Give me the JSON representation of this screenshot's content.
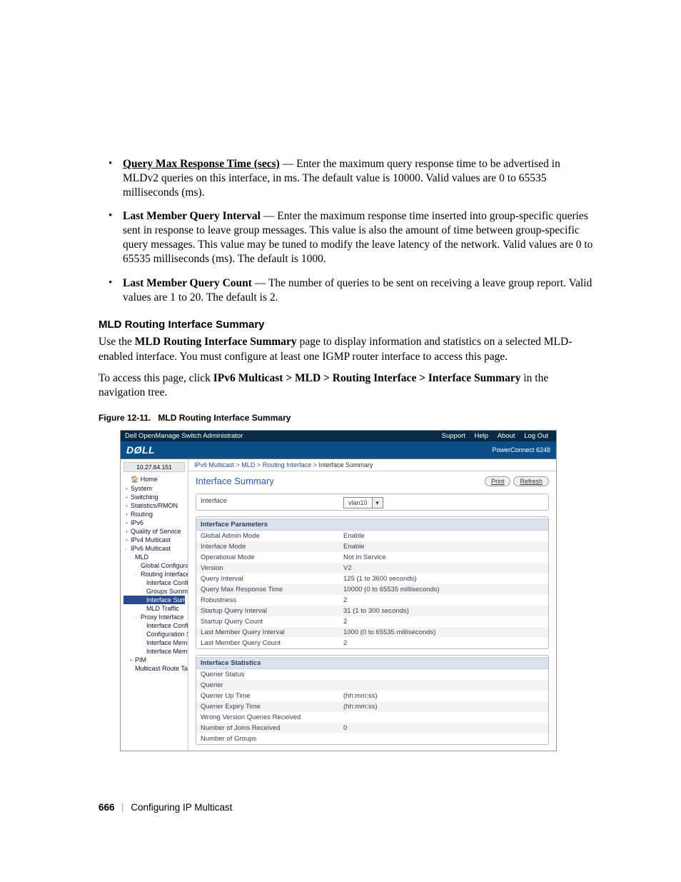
{
  "bullets": [
    {
      "term": "Query Max Response Time (secs)",
      "underline": true,
      "dash": " — ",
      "text": "Enter the maximum query response time to be advertised in MLDv2 queries on this interface, in ms. The default value is 10000. Valid values are 0 to 65535 milliseconds (ms)."
    },
    {
      "term": "Last Member Query Interval",
      "underline": false,
      "dash": " — ",
      "text": "Enter the maximum response time inserted into group-specific queries sent in response to leave group messages. This value is also the amount of time between group-specific query messages. This value may be tuned to modify the leave latency of the network. Valid values are 0 to 65535 milliseconds (ms). The default is 1000."
    },
    {
      "term": "Last Member Query Count",
      "underline": false,
      "dash": " — ",
      "text": "The number of queries to be sent on receiving a leave group report. Valid values are 1 to 20. The default is 2."
    }
  ],
  "section_title": "MLD Routing Interface Summary",
  "para1_pre": "Use the ",
  "para1_bold": "MLD Routing Interface Summary",
  "para1_post": " page to display information and statistics on a selected MLD-enabled interface. You must configure at least one IGMP router interface to access this page.",
  "para2_pre": "To access this page, click ",
  "para2_bold": "IPv6 Multicast > MLD > Routing Interface > Interface Summary",
  "para2_post": " in the navigation tree.",
  "fig_caption_num": "Figure 12-11.",
  "fig_caption_text": "MLD Routing Interface Summary",
  "shot": {
    "titlebar": {
      "title": "Dell OpenManage Switch Administrator",
      "links": [
        "Support",
        "Help",
        "About",
        "Log Out"
      ]
    },
    "brand": "DØLL",
    "model": "PowerConnect 6248",
    "ip": "10.27.64.151",
    "nav": [
      {
        "lvl": 0,
        "expand": "",
        "label": "Home",
        "sel": false,
        "home": true
      },
      {
        "lvl": 0,
        "expand": "+",
        "label": "System"
      },
      {
        "lvl": 0,
        "expand": "+",
        "label": "Switching"
      },
      {
        "lvl": 0,
        "expand": "+",
        "label": "Statistics/RMON"
      },
      {
        "lvl": 0,
        "expand": "+",
        "label": "Routing"
      },
      {
        "lvl": 0,
        "expand": "+",
        "label": "IPv6"
      },
      {
        "lvl": 0,
        "expand": "+",
        "label": "Quality of Service"
      },
      {
        "lvl": 0,
        "expand": "+",
        "label": "IPv4 Multicast"
      },
      {
        "lvl": 0,
        "expand": "-",
        "label": "IPv6 Multicast"
      },
      {
        "lvl": 1,
        "expand": "-",
        "label": "MLD"
      },
      {
        "lvl": 2,
        "expand": "",
        "label": "Global Configuratio"
      },
      {
        "lvl": 2,
        "expand": "-",
        "label": "Routing Interface"
      },
      {
        "lvl": 3,
        "expand": "",
        "label": "Interface Configu"
      },
      {
        "lvl": 3,
        "expand": "",
        "label": "Groups Summa"
      },
      {
        "lvl": 3,
        "expand": "",
        "label": "Interface Summ",
        "sel": true
      },
      {
        "lvl": 3,
        "expand": "",
        "label": "MLD Traffic"
      },
      {
        "lvl": 2,
        "expand": "-",
        "label": "Proxy Interface"
      },
      {
        "lvl": 3,
        "expand": "",
        "label": "Interface Configu"
      },
      {
        "lvl": 3,
        "expand": "",
        "label": "Configuration Su"
      },
      {
        "lvl": 3,
        "expand": "",
        "label": "Interface Membe"
      },
      {
        "lvl": 3,
        "expand": "",
        "label": "Interface Membe"
      },
      {
        "lvl": 1,
        "expand": "+",
        "label": "PIM"
      },
      {
        "lvl": 1,
        "expand": "",
        "label": "Multicast Route Table"
      }
    ],
    "crumbs": [
      "IPv6 Multicast",
      "MLD",
      "Routing Interface",
      "Interface Summary"
    ],
    "page_title": "Interface Summary",
    "buttons": {
      "print": "Print",
      "refresh": "Refresh"
    },
    "iface_label": "Interface",
    "iface_value": "vlan10",
    "params_header": "Interface Parameters",
    "params": [
      {
        "l": "Global Admin Mode",
        "v": "Enable"
      },
      {
        "l": "Interface Mode",
        "v": "Enable"
      },
      {
        "l": "Operational Mode",
        "v": "Not In Service"
      },
      {
        "l": "Version",
        "v": "V2"
      },
      {
        "l": "Query Interval",
        "v": "125  (1 to 3600 seconds)"
      },
      {
        "l": "Query Max Response Time",
        "v": "10000  (0 to 65535 milliseconds)"
      },
      {
        "l": "Robustness",
        "v": "2"
      },
      {
        "l": "Startup Query Interval",
        "v": "31  (1 to 300 seconds)"
      },
      {
        "l": "Startup Query Count",
        "v": "2"
      },
      {
        "l": "Last Member Query Interval",
        "v": "1000  (0 to 65535 milliseconds)"
      },
      {
        "l": "Last Member Query Count",
        "v": "2"
      }
    ],
    "stats_header": "Interface Statistics",
    "stats": [
      {
        "l": "Querier Status",
        "v": ""
      },
      {
        "l": "Querier",
        "v": ""
      },
      {
        "l": "Querier Up Time",
        "v": "(hh:mm:ss)"
      },
      {
        "l": "Querier Expiry Time",
        "v": "(hh:mm:ss)"
      },
      {
        "l": "Wrong Version Queries Received",
        "v": ""
      },
      {
        "l": "Number of Joins Received",
        "v": "0"
      },
      {
        "l": "Number of Groups",
        "v": ""
      }
    ]
  },
  "footer": {
    "page": "666",
    "chapter": "Configuring IP Multicast"
  }
}
